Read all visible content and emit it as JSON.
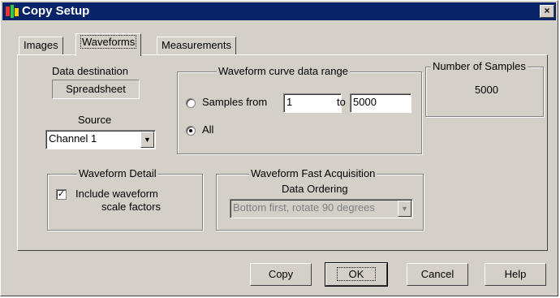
{
  "window": {
    "title": "Copy Setup",
    "close_glyph": "×"
  },
  "tabs": [
    {
      "label": "Images",
      "active": false
    },
    {
      "label": "Waveforms",
      "active": true
    },
    {
      "label": "Measurements",
      "active": false
    }
  ],
  "data_destination": {
    "label": "Data destination",
    "value": "Spreadsheet"
  },
  "source": {
    "label": "Source",
    "value": "Channel 1"
  },
  "range": {
    "group_label": "Waveform curve data range",
    "samples_from_label": "Samples from",
    "from_value": "1",
    "to_label": "to",
    "to_value": "5000",
    "all_label": "All",
    "selected": "all"
  },
  "num_samples": {
    "label": "Number of Samples",
    "value": "5000"
  },
  "detail": {
    "group_label": "Waveform Detail",
    "checkbox_line1": "Include waveform",
    "checkbox_line2": "scale factors",
    "checked": true
  },
  "fast_acq": {
    "group_label": "Waveform Fast Acquisition",
    "sub_label": "Data Ordering",
    "select_value": "Bottom first, rotate 90 degrees"
  },
  "buttons": {
    "copy": "Copy",
    "ok": "OK",
    "cancel": "Cancel",
    "help": "Help"
  },
  "colors": {
    "titlebar": "#0a246a",
    "face": "#d4d0c8"
  },
  "icons": {
    "app": "tek-app-icon",
    "close": "close-icon",
    "dropdown": "chevron-down-icon"
  }
}
